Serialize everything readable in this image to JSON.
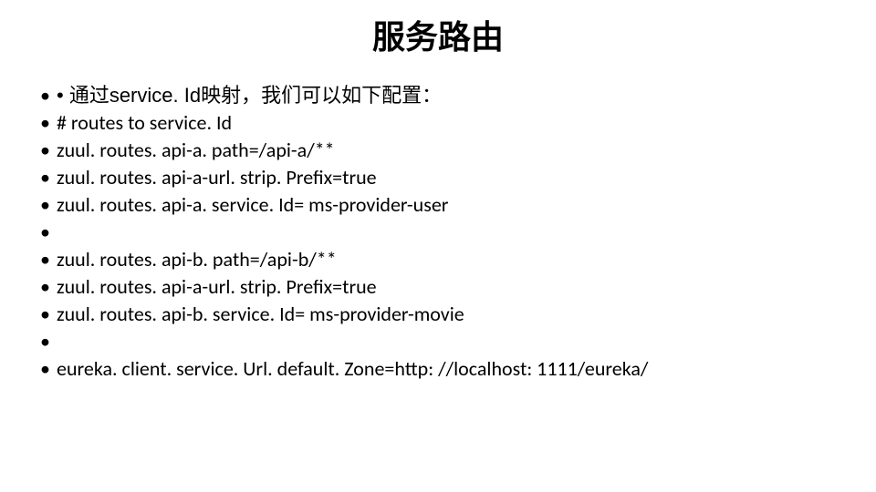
{
  "title": "服务路由",
  "bullets": [
    "• 通过service. Id映射，我们可以如下配置：",
    "# routes to service. Id",
    "zuul. routes. api-a. path=/api-a/**",
    "zuul. routes. api-a-url. strip. Prefix=true",
    "zuul. routes. api-a. service. Id= ms-provider-user",
    "",
    "zuul. routes. api-b. path=/api-b/**",
    "zuul. routes. api-a-url. strip. Prefix=true",
    "zuul. routes. api-b. service. Id= ms-provider-movie",
    "",
    "eureka. client. service. Url. default. Zone=http: //localhost: 1111/eureka/"
  ]
}
